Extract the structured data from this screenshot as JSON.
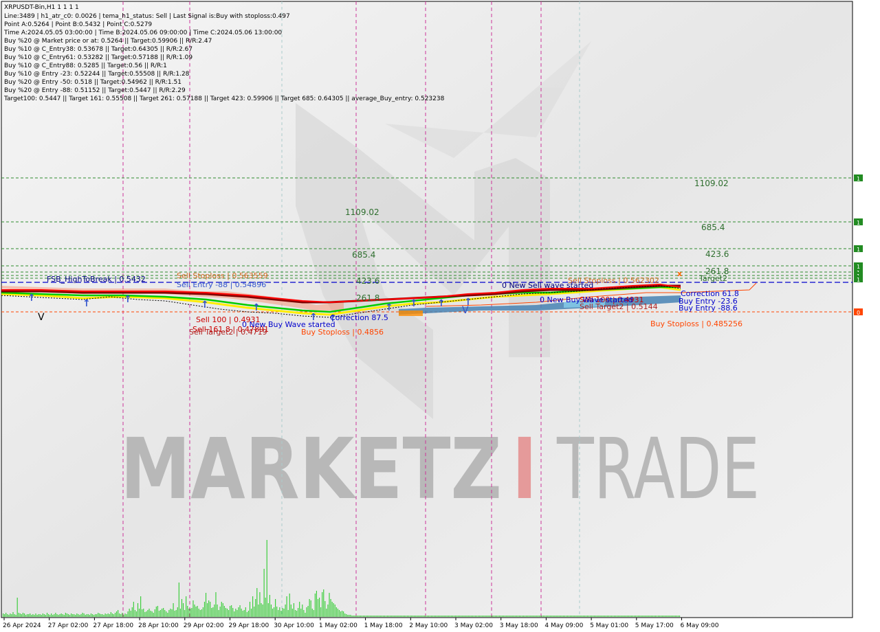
{
  "chart_data": {
    "type": "line",
    "title": "XRPUSDT-Bin,H1  1 1 1 1",
    "info_lines": [
      "Line:3489  |  h1_atr_c0: 0.0026  |  tema_h1_status: Sell  |  Last Signal is:Buy with stoploss:0.497",
      "Point A:0.5264  |  Point B:0.5432  |  Point C:0.5279",
      "Time A:2024.05.05 03:00:00  |  Time B:2024.05.06 09:00:00  |  Time C:2024.05.06 13:00:00",
      "Buy %20 @ Market price or at: 0.5264  ||  Target:0.59906  ||  R/R:2.47",
      "Buy %10 @ C_Entry38: 0.53678  ||  Target:0.64305  ||  R/R:2.67",
      "Buy %10 @ C_Entry61: 0.53282  ||  Target:0.57188  ||  R/R:1.09",
      "Buy %10 @ C_Entry88: 0.5285  ||  Target:0.56  ||  R/R:1",
      "Buy %10 @ Entry -23: 0.52244  ||  Target:0.55508  ||  R/R:1.28",
      "Buy %20 @ Entry -50: 0.518  ||  Target:0.54962  ||  R/R:1.51",
      "Buy %20 @ Entry -88: 0.51152  ||  Target:0.5447  ||  R/R:2.29",
      "Target100: 0.5447  ||  Target 161: 0.55508  ||  Target 261: 0.57188  ||  Target 423: 0.59906  ||  Target 685: 0.64305  ||  average_Buy_entry: 0.523238"
    ],
    "x_ticks": [
      "26 Apr 2024",
      "27 Apr 02:00",
      "27 Apr 18:00",
      "28 Apr 10:00",
      "29 Apr 02:00",
      "29 Apr 18:00",
      "30 Apr 10:00",
      "1 May 02:00",
      "1 May 18:00",
      "2 May 10:00",
      "3 May 02:00",
      "3 May 18:00",
      "4 May 09:00",
      "5 May 01:00",
      "5 May 17:00",
      "6 May 09:00"
    ],
    "right_markers": [
      "1",
      "1",
      "1",
      "1",
      "1",
      "1",
      "1",
      "0"
    ],
    "level_labels_right": [
      "1109.02",
      "685.4",
      "423.6",
      "261.8"
    ],
    "level_labels_mid": [
      "1109.02",
      "685.4",
      "423.6",
      "261.8"
    ],
    "price_labels": [
      "FSB_HighToBreak | 0.5432",
      "Sell Stoploss | 0.563559",
      "Sell Entry -88 | 0.54896",
      "Sell 100 | 0.4931",
      "Sell 161.8 | 0.47891",
      "Sell Target2 | 0.4719",
      "Buy Stoploss | 0.485256",
      "Sell Stoploss | 0.562302",
      "Sell Target2 | 0.5144",
      "Sell 100 | 0.4931",
      "0 New Buy Wave started",
      "0 New Sell wave started",
      "0 New Buy Wave started",
      "Buy Entry -88.6",
      "Buy Entry -23.6",
      "Correction 61.8",
      "Correction 87.5",
      "Buy Stoploss | 0.4856",
      "Target2"
    ],
    "watermark": [
      "MARKETZ",
      "I",
      "TRADE"
    ],
    "series_colors": {
      "price": "#000000",
      "tema": "#800000",
      "fast": "#ff0000",
      "slow": "#ffa500",
      "green": "#00cc00",
      "yellow": "#ffee00",
      "blue": "#0000cc",
      "cloud": "#4682b4",
      "volume": "#33cc33",
      "target_line": "#2e8b2e",
      "buy_level": "#0000cc",
      "stop_line": "#ff4500"
    },
    "volume": [
      5,
      4,
      6,
      4,
      3,
      5,
      4,
      7,
      4,
      3,
      28,
      6,
      5,
      4,
      6,
      5,
      3,
      4,
      4,
      5,
      3,
      4,
      3,
      5,
      3,
      4,
      4,
      3,
      5,
      4,
      3,
      6,
      4,
      3,
      5,
      3,
      4,
      6,
      4,
      3,
      4,
      5,
      4,
      3,
      6,
      5,
      4,
      3,
      5,
      4,
      4,
      3,
      5,
      4,
      3,
      4,
      6,
      5,
      3,
      4,
      4,
      3,
      5,
      4,
      3,
      4,
      4,
      6,
      5,
      4,
      4,
      3,
      5,
      4,
      5,
      4,
      7,
      5,
      4,
      6,
      8,
      10,
      5,
      4,
      6,
      3,
      5,
      4,
      8,
      12,
      9,
      14,
      22,
      10,
      8,
      20,
      12,
      30,
      11,
      12,
      7,
      8,
      10,
      12,
      9,
      8,
      6,
      11,
      15,
      16,
      9,
      10,
      12,
      13,
      10,
      8,
      6,
      10,
      12,
      11,
      20,
      9,
      10,
      14,
      50,
      12,
      26,
      20,
      10,
      30,
      16,
      12,
      12,
      13,
      24,
      18,
      15,
      16,
      12,
      10,
      11,
      14,
      22,
      35,
      20,
      24,
      22,
      13,
      14,
      18,
      36,
      18,
      10,
      15,
      22,
      20,
      16,
      13,
      12,
      10,
      16,
      17,
      13,
      8,
      12,
      10,
      14,
      17,
      12,
      9,
      10,
      14,
      7,
      9,
      22,
      12,
      30,
      15,
      26,
      42,
      18,
      36,
      20,
      18,
      70,
      28,
      112,
      20,
      32,
      18,
      12,
      14,
      26,
      15,
      10,
      14,
      9,
      13,
      12,
      18,
      30,
      10,
      34,
      18,
      12,
      20,
      10,
      9,
      13,
      22,
      12,
      18,
      10,
      6,
      14,
      16,
      26,
      24,
      12,
      10,
      34,
      38,
      26,
      28,
      14,
      36,
      40,
      23,
      12,
      18,
      35,
      26,
      22,
      20,
      18,
      14,
      12,
      10,
      8,
      9,
      8,
      5,
      4,
      3,
      3,
      3,
      2,
      2,
      2,
      2,
      2,
      2,
      2,
      2,
      2,
      2,
      2,
      2,
      2,
      2,
      2,
      2,
      2,
      2,
      2,
      2,
      2,
      2,
      2,
      2,
      2,
      2,
      2,
      2,
      2,
      2,
      2,
      2,
      2,
      2,
      2,
      2,
      2,
      2,
      2,
      2,
      2,
      2,
      2,
      2,
      2,
      2,
      2,
      2,
      2,
      2,
      2,
      2,
      2,
      2,
      2,
      2,
      2,
      2,
      2,
      2,
      2,
      2,
      2,
      2,
      2,
      2,
      2,
      2,
      2,
      2,
      2,
      2,
      2,
      2,
      2,
      2,
      2,
      2,
      2,
      2,
      2,
      2,
      2,
      2,
      2,
      2,
      2,
      2,
      2,
      2,
      2,
      2,
      2,
      2,
      2,
      2,
      2,
      2,
      2,
      2,
      2,
      2,
      2,
      2,
      2,
      2,
      2,
      2,
      2,
      2,
      2,
      2,
      2,
      2,
      2,
      2,
      2,
      2,
      2,
      2,
      2,
      2,
      2,
      2,
      2,
      2,
      2,
      2,
      2,
      2,
      2,
      2,
      2,
      2,
      2,
      2,
      2,
      2,
      2,
      2,
      2,
      2,
      2,
      2,
      2,
      2,
      2,
      2,
      2,
      2,
      2,
      2,
      2,
      2,
      2,
      2,
      2,
      2,
      2,
      2,
      2,
      2,
      2,
      2,
      2,
      2,
      2,
      2,
      2,
      2,
      2,
      2,
      2,
      2,
      2,
      2,
      2,
      2,
      2,
      2,
      2,
      2,
      2,
      2,
      2,
      2,
      2,
      2,
      2,
      2,
      2,
      2,
      2,
      2,
      2,
      2,
      2,
      2,
      2,
      2,
      2,
      2,
      2,
      2,
      2,
      2,
      2,
      2,
      2,
      2,
      2,
      2,
      2,
      2,
      2,
      2,
      2,
      2,
      2,
      2,
      2,
      2,
      2,
      2,
      2,
      2,
      2,
      2,
      2,
      2,
      2,
      2
    ]
  }
}
